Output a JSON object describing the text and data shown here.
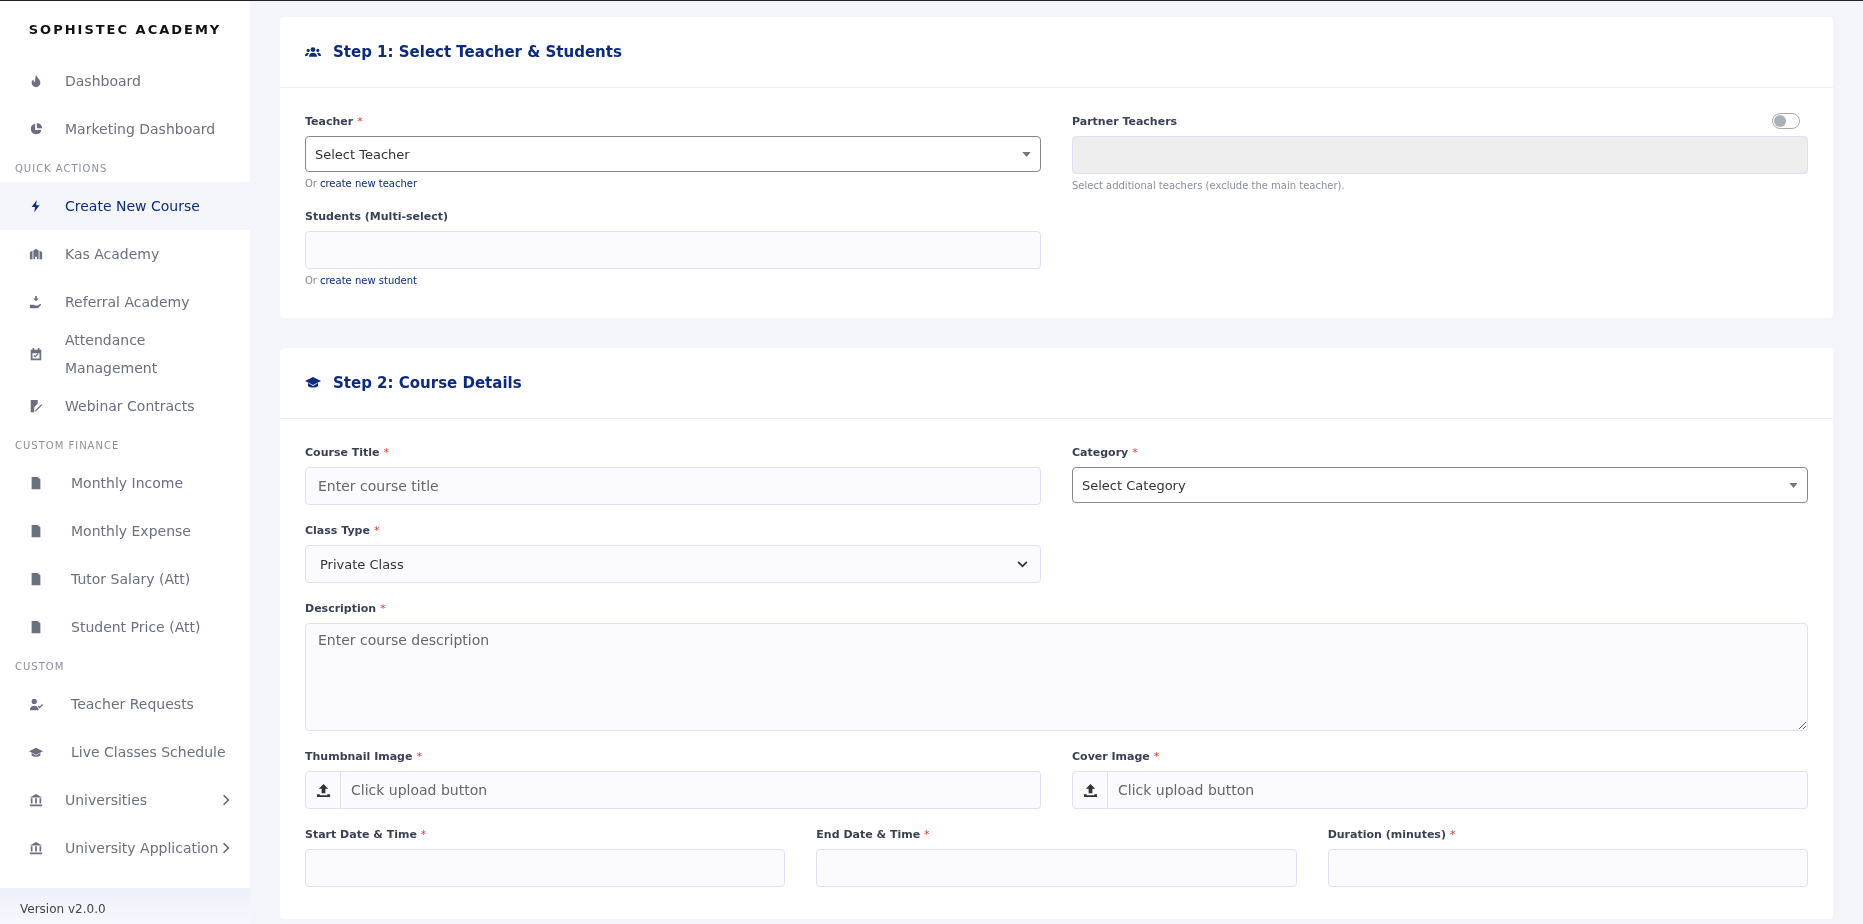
{
  "sidebar": {
    "brand": "SOPHISTEC ACADEMY",
    "items": [
      {
        "kind": "link",
        "label": "Dashboard",
        "selected": false
      },
      {
        "kind": "link",
        "label": "Marketing Dashboard",
        "selected": false
      },
      {
        "kind": "heading",
        "label": "QUICK ACTIONS"
      },
      {
        "kind": "link",
        "label": "Create New Course",
        "selected": true
      },
      {
        "kind": "link",
        "label": "Kas Academy",
        "selected": false
      },
      {
        "kind": "link",
        "label": "Referral Academy",
        "selected": false
      },
      {
        "kind": "link",
        "label": "Attendance Management",
        "selected": false
      },
      {
        "kind": "link",
        "label": "Webinar Contracts",
        "selected": false
      },
      {
        "kind": "heading",
        "label": "CUSTOM FINANCE"
      },
      {
        "kind": "link",
        "label": "Monthly Income",
        "selected": false
      },
      {
        "kind": "link",
        "label": "Monthly Expense",
        "selected": false
      },
      {
        "kind": "link",
        "label": "Tutor Salary (Att)",
        "selected": false
      },
      {
        "kind": "link",
        "label": "Student Price (Att)",
        "selected": false
      },
      {
        "kind": "heading",
        "label": "CUSTOM"
      },
      {
        "kind": "link",
        "label": "Teacher Requests",
        "selected": false
      },
      {
        "kind": "link",
        "label": "Live Classes Schedule",
        "selected": false
      },
      {
        "kind": "submenu",
        "label": "Universities",
        "selected": false
      },
      {
        "kind": "submenu",
        "label": "University Application",
        "selected": false
      }
    ],
    "version": "Version v2.0.0"
  },
  "steps": [
    {
      "title": "Step 1: Select Teacher & Students",
      "rows": [
        [
          {
            "kind": "select",
            "label": "Teacher",
            "required": "*",
            "value": "Select Teacher",
            "helper": {
              "prefix": "Or",
              "link": "create new teacher"
            }
          },
          {
            "kind": "multiselect",
            "label": "Partner Teachers",
            "disabled": true,
            "toggle": {
              "on": false
            },
            "helper": {
              "text": "Select additional teachers (exclude the main teacher)."
            }
          }
        ],
        [
          {
            "kind": "multiselect",
            "label": "Students (Multi-select)",
            "disabled": false,
            "helper": {
              "prefix": "Or",
              "link": "create new student"
            }
          }
        ]
      ]
    },
    {
      "title": "Step 2: Course Details",
      "rows": [
        [
          {
            "kind": "input",
            "label": "Course Title",
            "required": "*",
            "placeholder": "Enter course title"
          },
          {
            "kind": "select",
            "label": "Category",
            "required": "*",
            "value": "Select Category"
          }
        ],
        [
          {
            "kind": "native-select",
            "label": "Class Type",
            "required": "*",
            "value": "Private Class"
          }
        ],
        [
          {
            "kind": "textarea",
            "label": "Description",
            "required": "*",
            "placeholder": "Enter course description"
          }
        ],
        [
          {
            "kind": "upload",
            "label": "Thumbnail Image",
            "required": "*",
            "placeholder": "Click upload button"
          },
          {
            "kind": "upload",
            "label": "Cover Image",
            "required": "*",
            "placeholder": "Click upload button"
          }
        ],
        [
          {
            "kind": "input",
            "label": "Start Date & Time",
            "required": "*"
          },
          {
            "kind": "input",
            "label": "End Date & Time",
            "required": "*"
          },
          {
            "kind": "input",
            "label": "Duration (minutes)",
            "required": "*"
          }
        ]
      ]
    }
  ]
}
